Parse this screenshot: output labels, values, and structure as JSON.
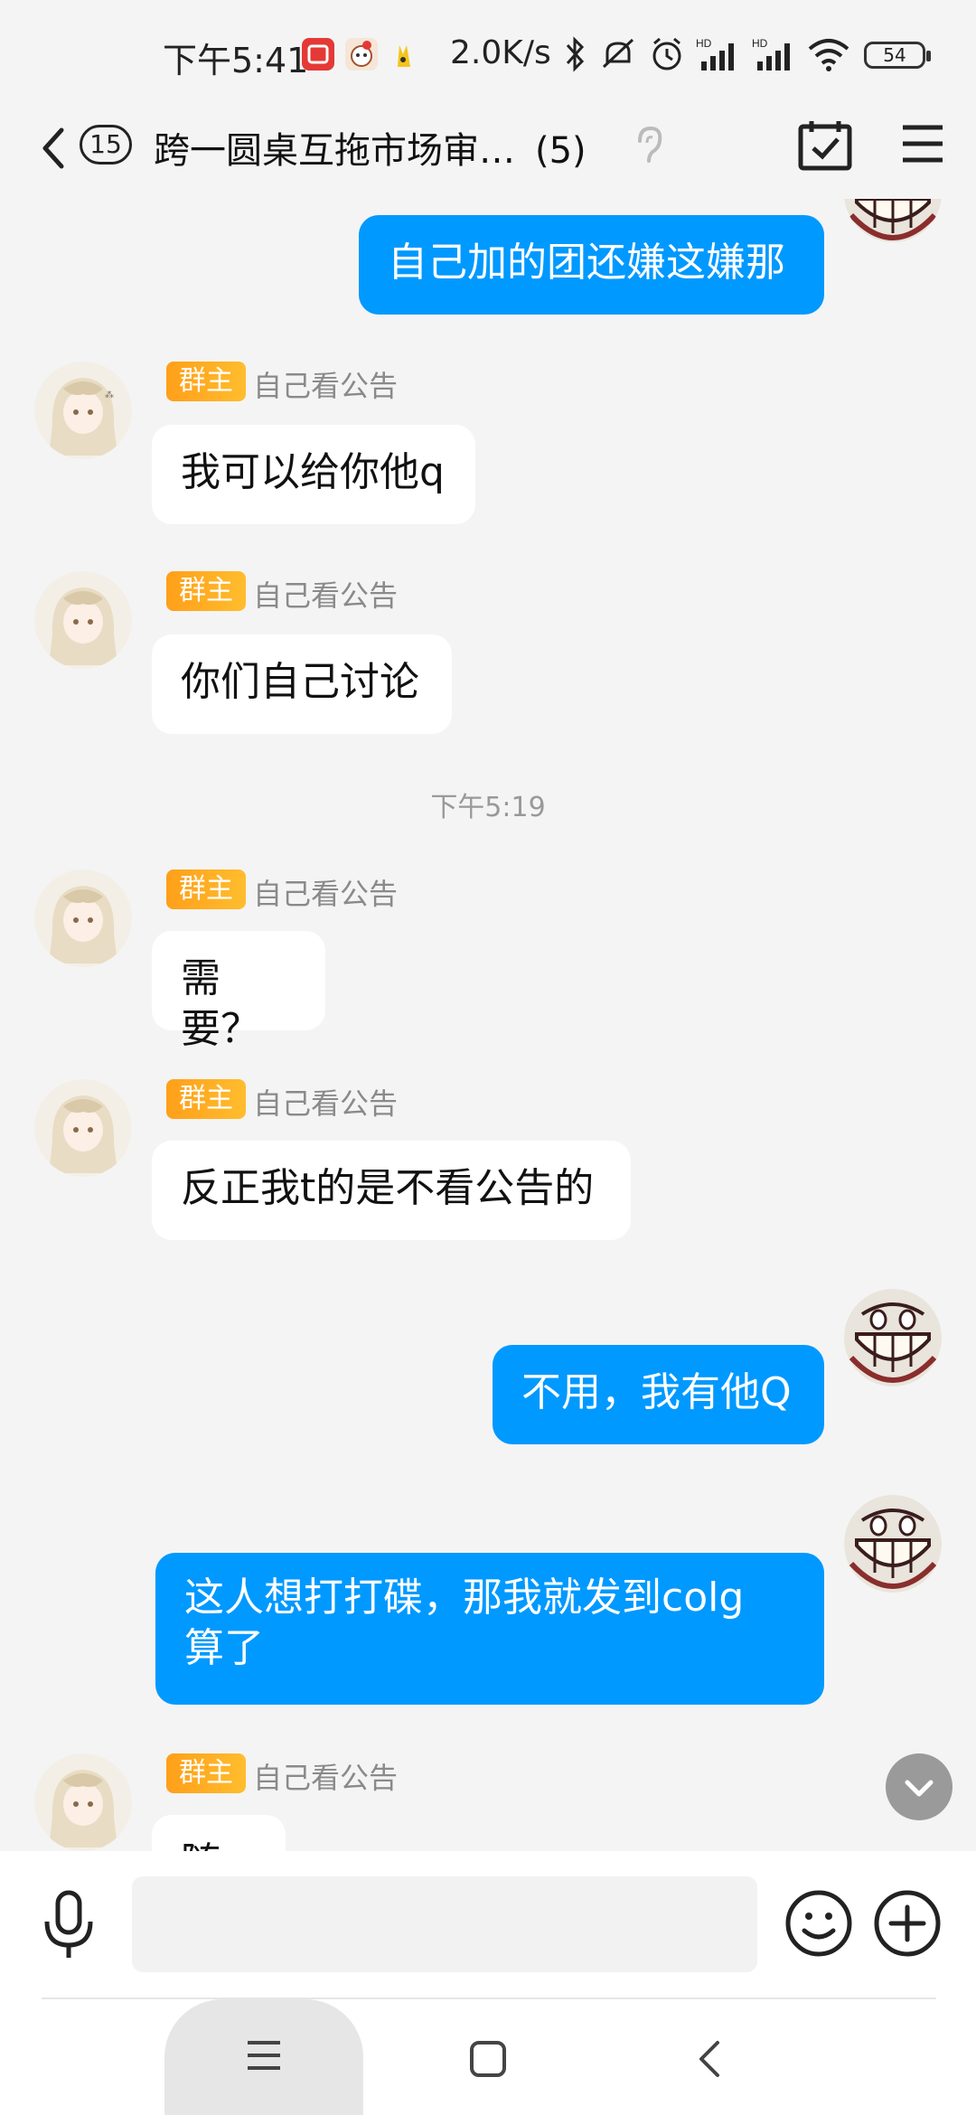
{
  "status_bar": {
    "time": "下午5:41",
    "net_speed": "2.0K/s",
    "battery": "54",
    "icons": [
      "notification-app-icon",
      "app-icon-2",
      "app-icon-3",
      "bluetooth-icon",
      "mute-icon",
      "alarm-icon",
      "hd-signal-icon",
      "hd-signal-icon",
      "wifi-icon",
      "battery-icon"
    ]
  },
  "header": {
    "unread_count": "15",
    "title": "跨一圆桌互拖市场审…",
    "member_count": "(5)",
    "icons": [
      "back-icon",
      "ear-icon",
      "calendar-check-icon",
      "menu-icon"
    ]
  },
  "sender": {
    "role": "群主",
    "name": "自己看公告"
  },
  "messages": [
    {
      "side": "out",
      "text": "自己加的团还嫌这嫌那"
    },
    {
      "side": "in",
      "text": "我可以给你他q"
    },
    {
      "side": "in",
      "text": "你们自己讨论"
    },
    {
      "side": "divider",
      "text": "下午5:19"
    },
    {
      "side": "in",
      "text": "需要？"
    },
    {
      "side": "in",
      "text": "反正我t的是不看公告的"
    },
    {
      "side": "out",
      "text": "不用，我有他Q"
    },
    {
      "side": "out",
      "text": "这人想打打碟，那我就发到colg算了"
    },
    {
      "side": "in",
      "text": "随你"
    }
  ],
  "message_lines": {
    "msg7_line1": "这人想打打碟，那我就发到colg",
    "msg7_line2": "算了"
  },
  "input": {
    "placeholder": "",
    "value": ""
  },
  "colors": {
    "outgoing_bubble": "#0099ff",
    "incoming_bubble": "#ffffff",
    "role_badge": "#ffa726",
    "background": "#f4f4f4"
  }
}
